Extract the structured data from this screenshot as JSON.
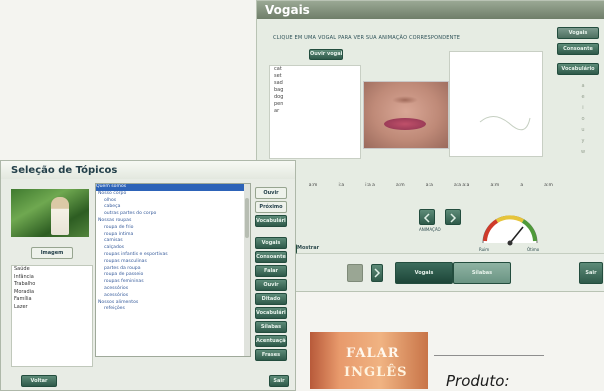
{
  "vogais": {
    "title": "Vogais",
    "instruction": "CLIQUE EM UMA VOGAL PARA VER SUA ANIMAÇÃO CORRESPONDENTE",
    "top_button": "Ouvir vogais",
    "vowels_list": [
      "cat",
      "set",
      "sad",
      "bag",
      "dog",
      "pen",
      "ar"
    ],
    "side_tabs": [
      "Vogais",
      "Consoante",
      "Vocabulário"
    ],
    "vertical_letters": [
      "a",
      "e",
      "i",
      "o",
      "u",
      "y",
      "w"
    ],
    "scale_values": [
      "a",
      "e",
      "a:m",
      "i:a",
      "i:a a",
      "a:m",
      "a:a",
      "a:a a:a",
      "a:m",
      "a",
      "a:m"
    ],
    "nav_caption": "ANIMAÇÃO",
    "gauge_labels": {
      "left": "Ruim",
      "right": "Ótimo"
    },
    "bottom_label": "Mostrar",
    "tabs": [
      "Vogais",
      "Sílabas"
    ],
    "far_right_button": "Sair"
  },
  "topicos": {
    "title": "Seleção de Tópicos",
    "image_button": "Imagem",
    "left_list": [
      "Saúde",
      "Infância",
      "Trabalho",
      "Moradia",
      "Família",
      "Lazer"
    ],
    "topics": [
      {
        "text": "Quem somos",
        "kind": "sel"
      },
      {
        "text": "Nosso corpo",
        "kind": "cat"
      },
      {
        "text": "olhos",
        "kind": "sub"
      },
      {
        "text": "cabeça",
        "kind": "sub"
      },
      {
        "text": "outras partes do corpo",
        "kind": "sub"
      },
      {
        "text": "Nossas roupas",
        "kind": "cat"
      },
      {
        "text": "roupa de frio",
        "kind": "sub"
      },
      {
        "text": "roupa íntima",
        "kind": "sub"
      },
      {
        "text": "camisas",
        "kind": "sub"
      },
      {
        "text": "calçados",
        "kind": "sub"
      },
      {
        "text": "roupas infantis e esportivas",
        "kind": "sub"
      },
      {
        "text": "roupas masculinas",
        "kind": "sub"
      },
      {
        "text": "partes da roupa",
        "kind": "sub"
      },
      {
        "text": "roupa de passeio",
        "kind": "sub"
      },
      {
        "text": "roupas femininas",
        "kind": "sub"
      },
      {
        "text": "acessórios",
        "kind": "sub"
      },
      {
        "text": "acessórios",
        "kind": "sub"
      },
      {
        "text": "Nossos alimentos",
        "kind": "cat"
      },
      {
        "text": "refeições",
        "kind": "sub"
      }
    ],
    "side_buttons_top": [
      "Ouvir",
      "Próximo",
      "Vocabulário"
    ],
    "side_buttons": [
      "Vogais",
      "Consoante",
      "Falar",
      "Ouvir",
      "Ditado",
      "Vocabulário",
      "Sílabas",
      "Acentuação",
      "Frases"
    ],
    "footer_button": "Voltar",
    "footer_right": "Sair"
  },
  "product": {
    "line1": "FALAR",
    "line2": "INGLÊS",
    "caption": "Produto:"
  }
}
